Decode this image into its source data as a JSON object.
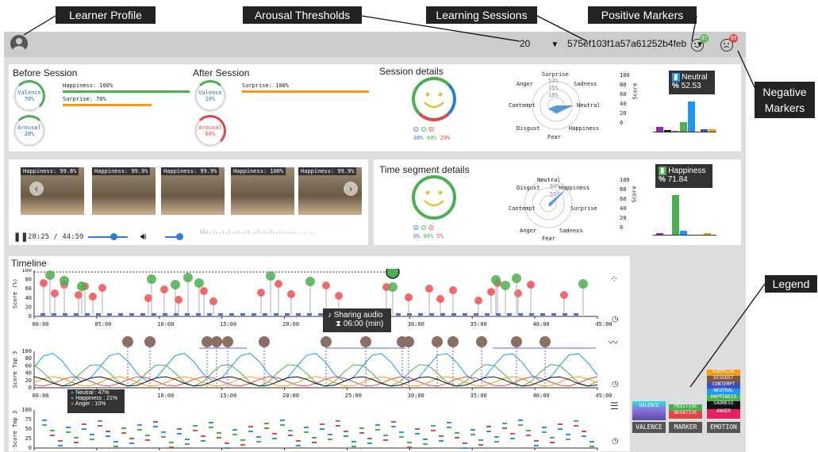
{
  "callouts": {
    "learner_profile": "Learner Profile",
    "arousal_thresholds": "Arousal Thresholds",
    "learning_sessions": "Learning Sessions",
    "positive_markers": "Positive Markers",
    "negative_markers_1": "Negative",
    "negative_markers_2": "Markers",
    "legend": "Legend"
  },
  "topbar": {
    "threshold_value": "20",
    "session_id": "575ef103f1a57a61252b4feb",
    "positive_count": "37",
    "negative_count": "95"
  },
  "before": {
    "title": "Before Session",
    "valence_label": "Valence",
    "valence_value": "70%",
    "arousal_label": "Arousal",
    "arousal_value": "20%",
    "bar1": "Happiness: 100%",
    "bar2": "Surprise: 70%"
  },
  "after": {
    "title": "After Session",
    "valence_label": "Valence",
    "valence_value": "10%",
    "arousal_label": "Arousal",
    "arousal_value": "60%",
    "bar1": "Surprise: 100%"
  },
  "session_details": {
    "title": "Session details",
    "pct_pos": "30%",
    "pct_neu": "40%",
    "pct_neg": "29%",
    "radar": {
      "surprise": "Surprise",
      "anger": "Anger",
      "sadness": "Sadness",
      "contempt": "Contempt",
      "neutral": "Neutral",
      "disgust": "Disgust",
      "happiness": "Happiness",
      "fear": "Fear",
      "t53": "53%",
      "t35": "35%",
      "t18": "18%"
    },
    "tooltip_label": "Neutral",
    "tooltip_value": "52.53",
    "score_axis": "Score",
    "yticks": [
      "100",
      "80",
      "60",
      "40",
      "20",
      "0"
    ]
  },
  "video": {
    "thumbs": [
      "Happiness: 99.8%",
      "Happiness: 99.9%",
      "Happiness: 99.9%",
      "Happiness: 100%",
      "Happiness: 99.9%"
    ],
    "time": "28:25 / 44:59"
  },
  "segment_details": {
    "title": "Time segment details",
    "pct_pos": "0%",
    "pct_neu": "86%",
    "pct_neg": "5%",
    "radar": {
      "neutral": "Neutral",
      "disgust": "Disgust",
      "happiness": "Happiness",
      "contempt": "Contempt",
      "surprise": "Surprise",
      "anger": "Anger",
      "sadness": "Sadness",
      "fear": "Fear",
      "t84": "84%",
      "t55": "55%"
    },
    "tooltip_label": "Happiness",
    "tooltip_value": "71.84",
    "score_axis": "Score",
    "yticks": [
      "100",
      "80",
      "60",
      "40",
      "20",
      "0"
    ]
  },
  "timeline": {
    "title": "Timeline",
    "xticks": [
      "00:00",
      "05:00",
      "10:00",
      "15:00",
      "20:00",
      "25:00",
      "30:00",
      "35:00",
      "40:00",
      "45:00"
    ],
    "yticks1": [
      "100",
      "80",
      "60",
      "40",
      "20",
      "0"
    ],
    "yticks2": [
      "100",
      "80",
      "60",
      "40",
      "20",
      "0"
    ],
    "yticks3": [
      "100",
      "75",
      "50",
      "25",
      "0"
    ],
    "axis1": "Score (%)",
    "axis2": "Score Top 3",
    "axis3": "Score Top 3",
    "audio_tooltip_1": "Sharing audio",
    "audio_tooltip_2": "06:00 (min)",
    "emo_tooltip": [
      "Neutral : 47%",
      "Happiness : 21%",
      "Anger : 10%"
    ]
  },
  "legend": {
    "valence": "VALENCE",
    "marker": "MARKER",
    "emotion": "EMOTION",
    "items_valence": [
      "VALENCE"
    ],
    "items_marker": [
      "POSITIVE",
      "NEGATIVE"
    ],
    "items_emotion": [
      "SURPRISE",
      "DISGUST",
      "CONTEMPT",
      "NEUTRAL",
      "HAPPINESS",
      "SADNESS",
      "ANGER"
    ]
  }
}
